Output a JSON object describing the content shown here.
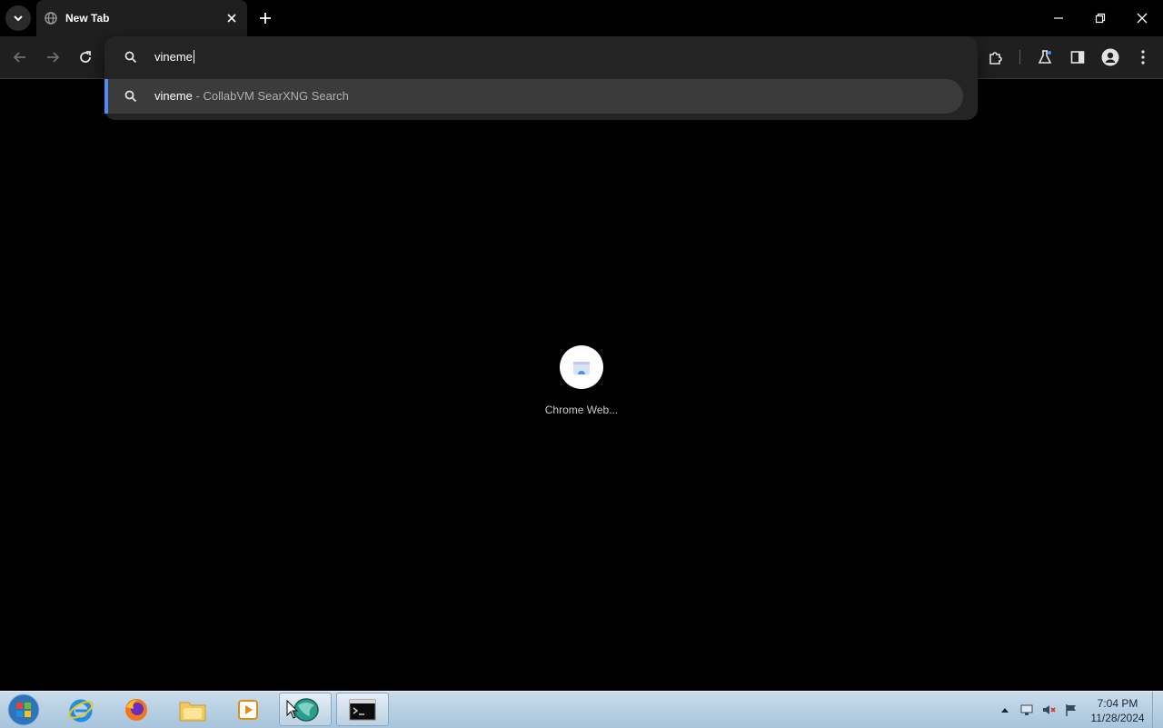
{
  "tab": {
    "title": "New Tab"
  },
  "omnibox": {
    "query": "vineme",
    "suggestion": {
      "query": "vineme",
      "separator": "-",
      "engine": "CollabVM SearXNG Search"
    }
  },
  "shortcut": {
    "label": "Chrome Web..."
  },
  "taskbar": {
    "items": [
      "start-orb",
      "internet-explorer",
      "firefox",
      "file-explorer",
      "media-player",
      "app-globe",
      "command-prompt"
    ],
    "clock": {
      "time": "7:04 PM",
      "date": "11/28/2024"
    }
  },
  "colors": {
    "accent": "#4c8df6",
    "background": "#000000",
    "toolbar": "#1f1f1f"
  }
}
